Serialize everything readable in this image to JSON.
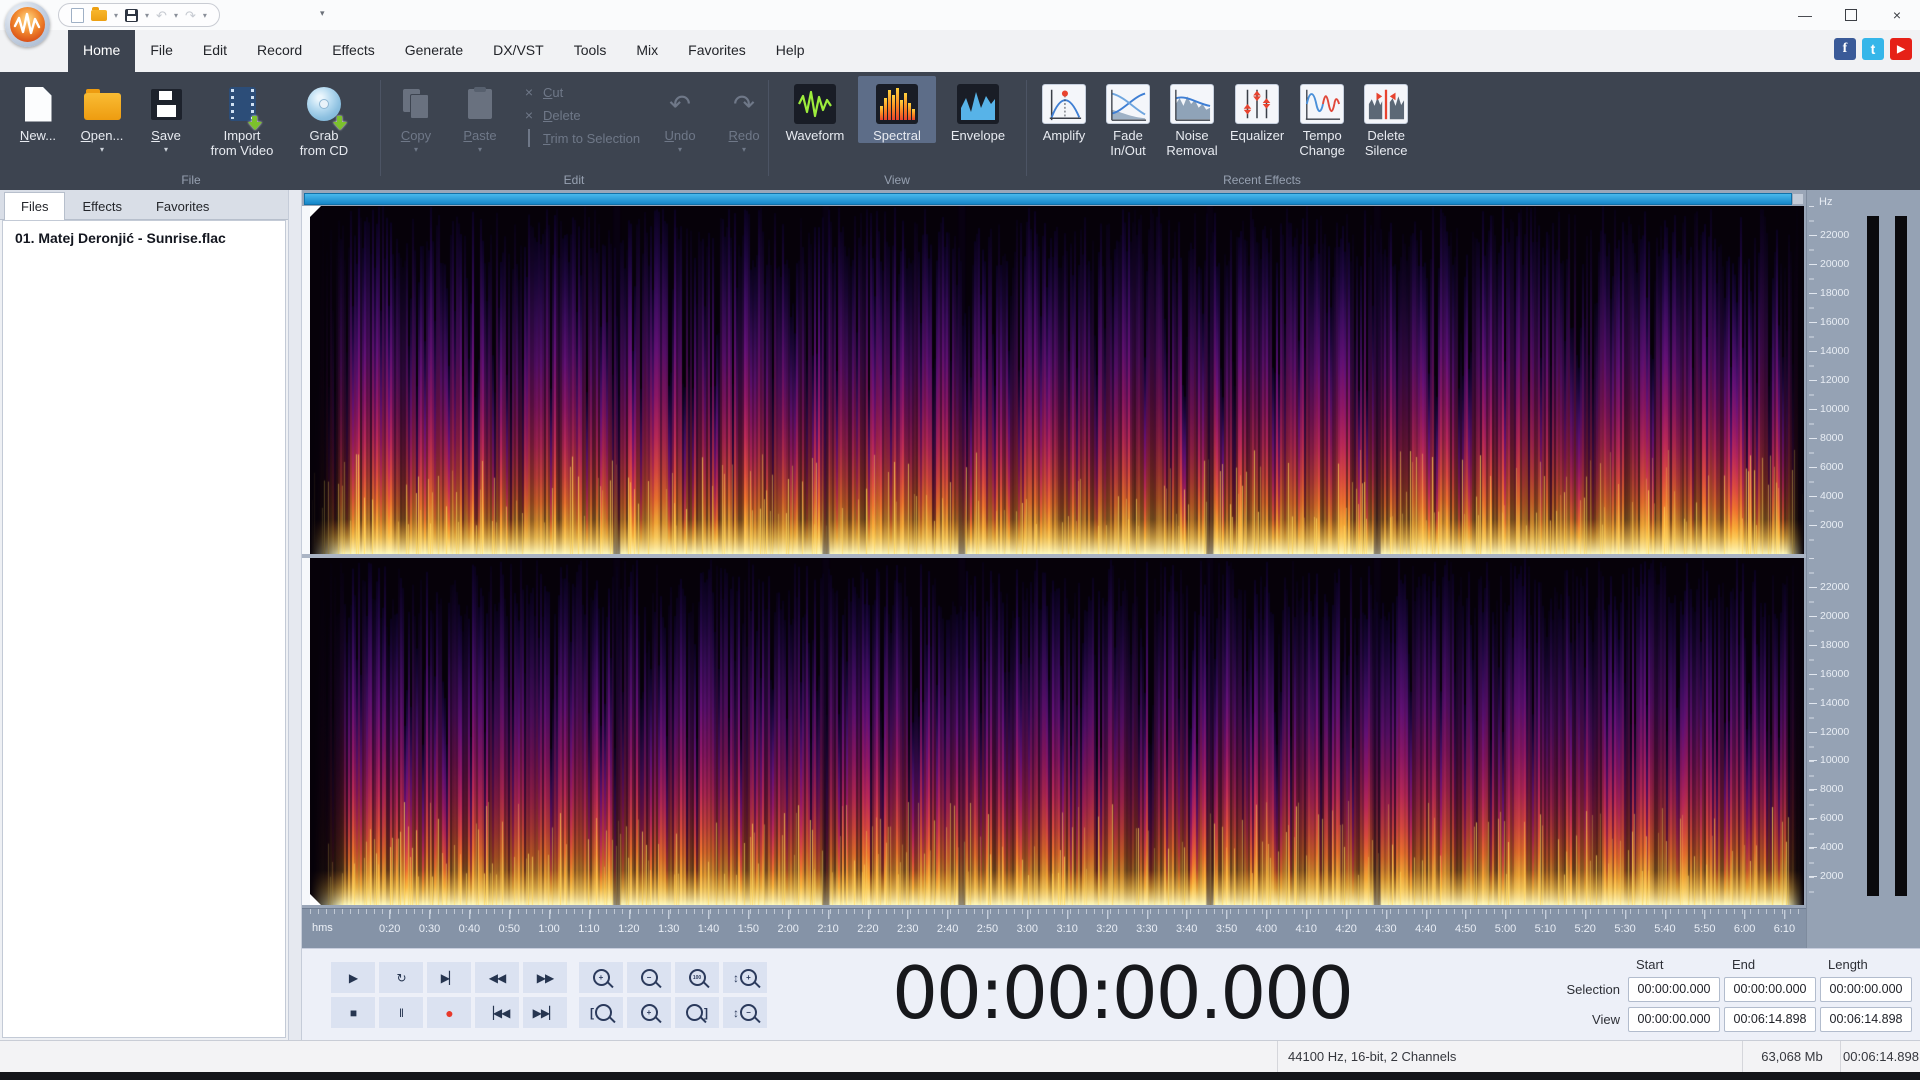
{
  "window": {
    "minimize": "—",
    "close": "×"
  },
  "menu": {
    "items": [
      {
        "label": "Home",
        "active": true
      },
      {
        "label": "File"
      },
      {
        "label": "Edit"
      },
      {
        "label": "Record"
      },
      {
        "label": "Effects"
      },
      {
        "label": "Generate"
      },
      {
        "label": "DX/VST"
      },
      {
        "label": "Tools"
      },
      {
        "label": "Mix"
      },
      {
        "label": "Favorites"
      },
      {
        "label": "Help"
      }
    ],
    "social": {
      "facebook": "f",
      "twitter": "t",
      "youtube": "▶"
    }
  },
  "ribbon": {
    "groups": [
      {
        "label": "File",
        "buttons": [
          {
            "label": "New..."
          },
          {
            "label": "Open...",
            "dropdown": true
          },
          {
            "label": "Save",
            "dropdown": true
          },
          {
            "label": "Import",
            "label2": "from Video"
          },
          {
            "label": "Grab",
            "label2": "from CD"
          }
        ]
      },
      {
        "label": "Edit",
        "buttons": [
          {
            "label": "Copy",
            "dropdown": true
          },
          {
            "label": "Paste",
            "dropdown": true
          },
          {
            "label": "Cut"
          },
          {
            "label": "Delete"
          },
          {
            "label": "Trim to Selection"
          },
          {
            "label": "Undo",
            "dropdown": true
          },
          {
            "label": "Redo",
            "dropdown": true
          }
        ]
      },
      {
        "label": "View",
        "buttons": [
          {
            "label": "Waveform"
          },
          {
            "label": "Spectral",
            "active": true
          },
          {
            "label": "Envelope"
          }
        ]
      },
      {
        "label": "Recent Effects",
        "buttons": [
          {
            "label": "Amplify"
          },
          {
            "label": "Fade",
            "label2": "In/Out"
          },
          {
            "label": "Noise",
            "label2": "Removal"
          },
          {
            "label": "Equalizer"
          },
          {
            "label": "Tempo",
            "label2": "Change"
          },
          {
            "label": "Delete",
            "label2": "Silence"
          }
        ]
      }
    ],
    "icons": {
      "cut": "×",
      "delete": "×",
      "undo": "↶",
      "redo": "↷",
      "dropdown": "▾"
    }
  },
  "panel": {
    "tabs": [
      {
        "label": "Files",
        "active": true
      },
      {
        "label": "Effects"
      },
      {
        "label": "Favorites"
      }
    ],
    "files": [
      "01. Matej Deronjić - Sunrise.flac"
    ]
  },
  "ruler": {
    "unit": "hms",
    "first_s": 20,
    "step_s": 10,
    "total_s": 374.898,
    "labels": [
      "0:20",
      "0:30",
      "0:40",
      "0:50",
      "1:00",
      "1:10",
      "1:20",
      "1:30",
      "1:40",
      "1:50",
      "2:00",
      "2:10",
      "2:20",
      "2:30",
      "2:40",
      "2:50",
      "3:00",
      "3:10",
      "3:20",
      "3:30",
      "3:40",
      "3:50",
      "4:00",
      "4:10",
      "4:20",
      "4:30",
      "4:40",
      "4:50",
      "5:00",
      "5:10",
      "5:20",
      "5:30",
      "5:40",
      "5:50",
      "6:00",
      "6:10"
    ]
  },
  "freq_axis": {
    "unit": "Hz",
    "max_hz": 24000,
    "labels": [
      "22000",
      "20000",
      "18000",
      "16000",
      "14000",
      "12000",
      "10000",
      "8000",
      "6000",
      "4000",
      "2000"
    ]
  },
  "transport": {
    "playback": [
      [
        {
          "name": "play",
          "glyph": "▶"
        },
        {
          "name": "loop",
          "glyph": "↻"
        },
        {
          "name": "play-to-end",
          "glyph": "▶▏"
        },
        {
          "name": "rewind",
          "glyph": "◀◀"
        },
        {
          "name": "fast-forward",
          "glyph": "▶▶"
        }
      ],
      [
        {
          "name": "stop",
          "glyph": "■"
        },
        {
          "name": "pause",
          "glyph": "‖"
        },
        {
          "name": "record",
          "glyph": "●",
          "record": true
        },
        {
          "name": "go-to-start",
          "glyph": "▕◀◀"
        },
        {
          "name": "go-to-end",
          "glyph": "▶▶▏"
        }
      ]
    ],
    "zoom": [
      [
        {
          "name": "zoom-in",
          "mod": "+"
        },
        {
          "name": "zoom-out",
          "mod": "−"
        },
        {
          "name": "zoom-100",
          "mod": "100"
        },
        {
          "name": "zoom-vertical-in",
          "pre": "↕",
          "mod": "+"
        }
      ],
      [
        {
          "name": "zoom-selection-start",
          "pre": "[",
          "mod": ""
        },
        {
          "name": "zoom-selection",
          "mod": "+"
        },
        {
          "name": "zoom-selection-end",
          "suf": "]",
          "mod": ""
        },
        {
          "name": "zoom-vertical-out",
          "pre": "↕",
          "mod": "−"
        }
      ]
    ]
  },
  "time_display": "00:00:00.000",
  "selection_panel": {
    "headers": [
      "Start",
      "End",
      "Length"
    ],
    "rows": [
      {
        "label": "Selection",
        "values": [
          "00:00:00.000",
          "00:00:00.000",
          "00:00:00.000"
        ]
      },
      {
        "label": "View",
        "values": [
          "00:00:00.000",
          "00:06:14.898",
          "00:06:14.898"
        ]
      }
    ]
  },
  "status_bar": {
    "format": "44100 Hz, 16-bit, 2 Channels",
    "size": "63,068 Mb",
    "length": "00:06:14.898"
  },
  "spectrogram": {
    "channels": 2,
    "background": "#060109",
    "colormap": [
      {
        "p": 0.0,
        "c": "#fffdc8"
      },
      {
        "p": 0.045,
        "c": "#ffe27a"
      },
      {
        "p": 0.09,
        "c": "#fdb23a"
      },
      {
        "p": 0.16,
        "c": "#f4762f"
      },
      {
        "p": 0.24,
        "c": "#e04b41"
      },
      {
        "p": 0.34,
        "c": "#c02a5a"
      },
      {
        "p": 0.46,
        "c": "#93186a"
      },
      {
        "p": 0.6,
        "c": "#651179"
      },
      {
        "p": 0.74,
        "c": "#3f0d63"
      },
      {
        "p": 0.87,
        "c": "#1f0742"
      },
      {
        "p": 1.0,
        "c": "#0a0220"
      }
    ],
    "dark_bands": [
      0.205,
      0.345,
      0.436,
      0.602,
      0.714
    ],
    "seeds": [
      7,
      13
    ]
  }
}
